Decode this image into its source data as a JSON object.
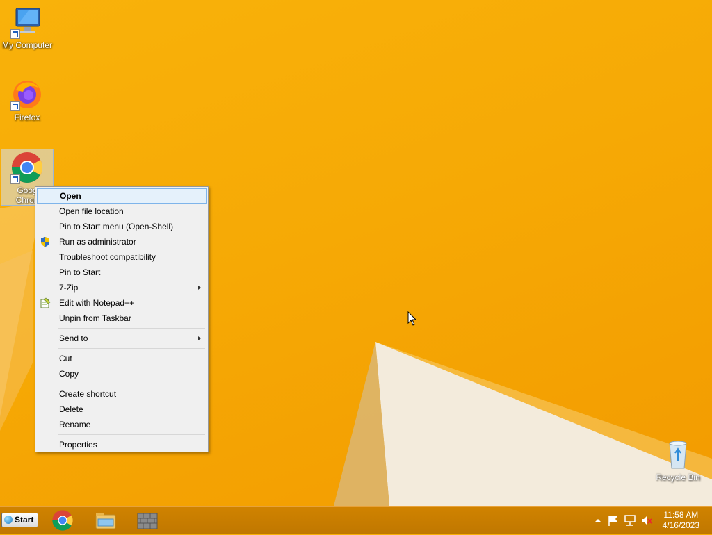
{
  "desktop": {
    "icons": [
      {
        "label": "My Computer",
        "icon": "computer-icon"
      },
      {
        "label": "Firefox",
        "icon": "firefox-icon"
      },
      {
        "label": "Google Chrome",
        "label_line1": "Goog",
        "label_line2": "Chron",
        "icon": "chrome-icon"
      },
      {
        "label": "Recycle Bin",
        "icon": "recycle-bin-icon"
      }
    ]
  },
  "context_menu": {
    "items": [
      {
        "label": "Open",
        "bold": true,
        "highlighted": true
      },
      {
        "label": "Open file location"
      },
      {
        "label": "Pin to Start menu (Open-Shell)"
      },
      {
        "label": "Run as administrator",
        "icon": "uac-shield-icon"
      },
      {
        "label": "Troubleshoot compatibility"
      },
      {
        "label": "Pin to Start"
      },
      {
        "label": "7-Zip",
        "submenu": true
      },
      {
        "label": "Edit with Notepad++",
        "icon": "notepadpp-icon"
      },
      {
        "label": "Unpin from Taskbar"
      },
      {
        "label": "Send to",
        "submenu": true
      },
      {
        "label": "Cut"
      },
      {
        "label": "Copy"
      },
      {
        "label": "Create shortcut"
      },
      {
        "label": "Delete"
      },
      {
        "label": "Rename"
      },
      {
        "label": "Properties"
      }
    ]
  },
  "taskbar": {
    "start_label": "Start",
    "pinned": [
      "chrome-icon",
      "file-explorer-icon",
      "firewall-icon"
    ],
    "tray": [
      "show-hidden-icons-icon",
      "action-center-flag-icon",
      "network-icon",
      "volume-muted-icon"
    ],
    "time": "11:58 AM",
    "date": "4/16/2023"
  },
  "colors": {
    "wallpaper": "#f6a905",
    "taskbar": "#c87d00",
    "menu_background": "#f0f0f0",
    "menu_highlight": "#e5f1fb",
    "menu_highlight_border": "#7eb4ea"
  }
}
